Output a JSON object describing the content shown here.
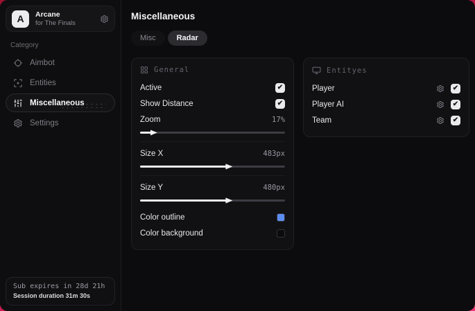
{
  "app": {
    "logo_letter": "A",
    "name": "Arcane",
    "subtitle": "for The Finals"
  },
  "sidebar": {
    "category_label": "Category",
    "items": [
      {
        "label": "Aimbot"
      },
      {
        "label": "Entities"
      },
      {
        "label": "Miscellaneous"
      },
      {
        "label": "Settings"
      }
    ],
    "footer": {
      "sub_expires": "Sub expires in 28d 21h",
      "session_duration": "Session duration 31m 30s"
    }
  },
  "main": {
    "title": "Miscellaneous",
    "tabs": {
      "misc": "Misc",
      "radar": "Radar"
    },
    "general": {
      "title": "General",
      "active_label": "Active",
      "active_checked": "✔",
      "show_distance_label": "Show Distance",
      "show_distance_checked": "✔",
      "zoom_label": "Zoom",
      "zoom_value": "17%",
      "zoom_fill": "8%",
      "size_x_label": "Size X",
      "size_x_value": "483px",
      "size_x_fill": "60%",
      "size_y_label": "Size Y",
      "size_y_value": "480px",
      "size_y_fill": "60%",
      "color_outline_label": "Color outline",
      "color_outline": "#5b8def",
      "color_background_label": "Color background",
      "color_background": "#0b0b0d"
    },
    "entities": {
      "title": "Entityes",
      "rows": [
        {
          "label": "Player",
          "checked": "✔"
        },
        {
          "label": "Player AI",
          "checked": "✔"
        },
        {
          "label": "Team",
          "checked": "✔"
        }
      ]
    }
  }
}
